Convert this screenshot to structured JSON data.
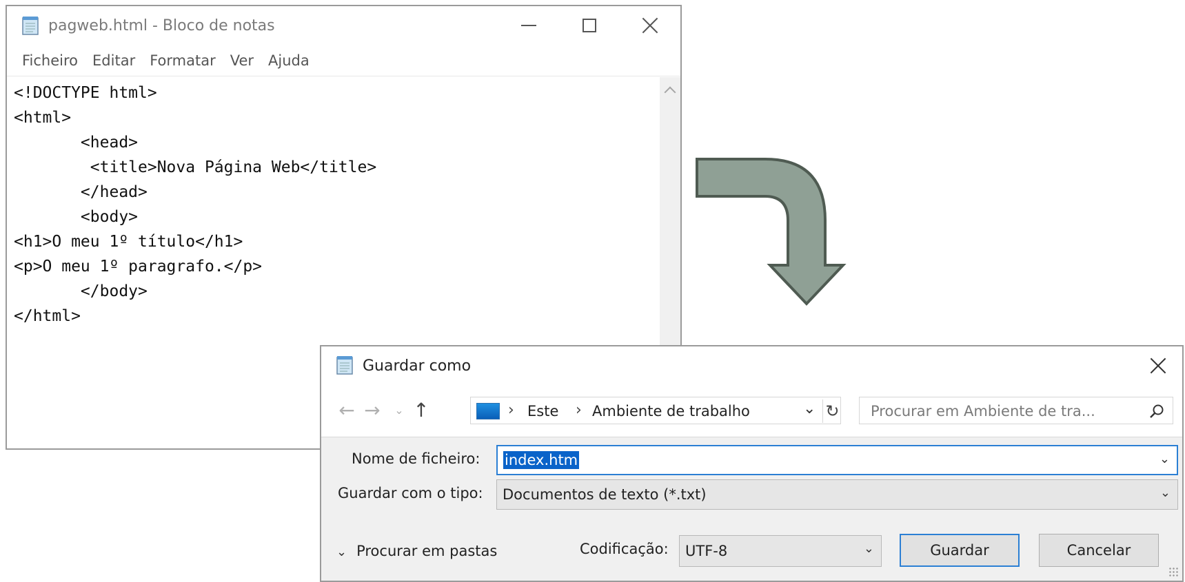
{
  "notepad": {
    "title": "pagweb.html - Bloco de notas",
    "menu": [
      "Ficheiro",
      "Editar",
      "Formatar",
      "Ver",
      "Ajuda"
    ],
    "lines": [
      "<!DOCTYPE html>",
      "<html>",
      "       <head>",
      "        <title>Nova Página Web</title>",
      "       </head>",
      "       <body>",
      "<h1>O meu 1º título</h1>",
      "<p>O meu 1º paragrafo.</p>",
      "       </body>",
      "</html>"
    ]
  },
  "dialog": {
    "title": "Guardar como",
    "address": {
      "segment_1": "Este",
      "segment_2": "Ambiente de trabalho"
    },
    "search_placeholder": "Procurar em Ambiente de tra...",
    "filename_label": "Nome de ficheiro:",
    "filename_value": "index.htm",
    "filetype_label": "Guardar com o tipo:",
    "filetype_value": "Documentos de texto (*.txt)",
    "browse_folders": "Procurar em pastas",
    "encoding_label": "Codificação:",
    "encoding_value": "UTF-8",
    "save_button": "Guardar",
    "cancel_button": "Cancelar"
  },
  "colors": {
    "arrow_fill": "#8fa095",
    "arrow_stroke": "#4f5b52",
    "accent": "#2b7fd4",
    "selection": "#0a63c9"
  },
  "icons": {
    "notepad_icon": "notepad-icon",
    "search_icon": "search-icon",
    "up_icon": "arrow-up-icon"
  }
}
